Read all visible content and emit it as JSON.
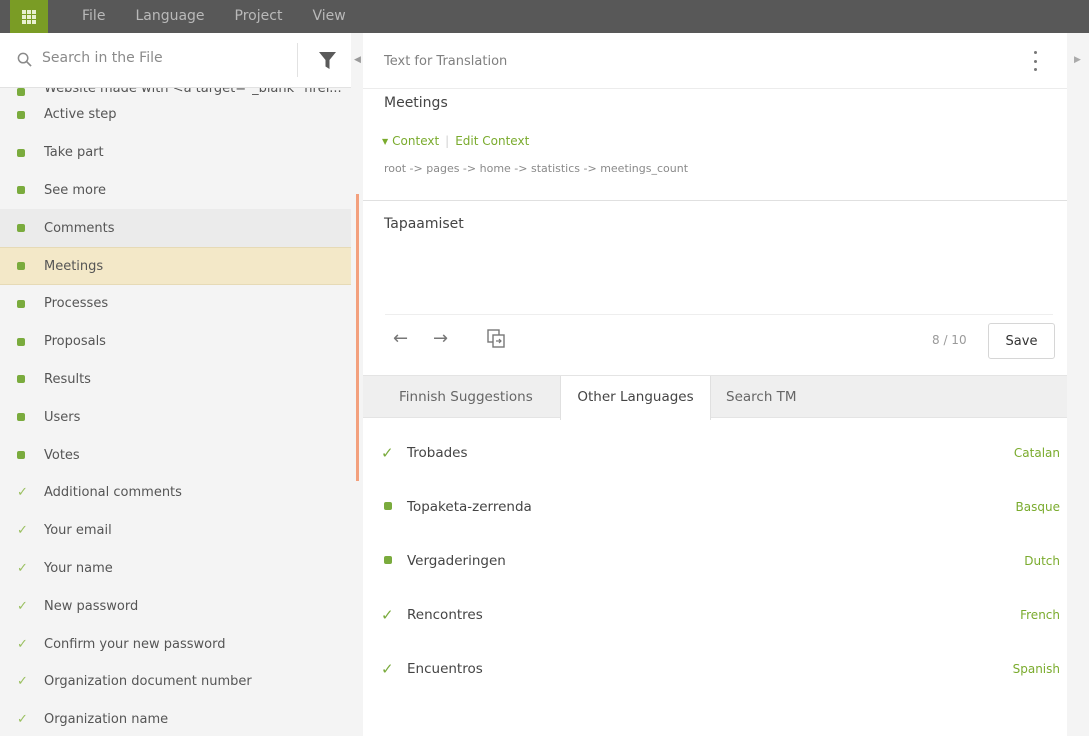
{
  "menubar": {
    "items": [
      "File",
      "Language",
      "Project",
      "View"
    ]
  },
  "sidebar": {
    "search_placeholder": "Search in the File",
    "items": [
      {
        "label": "Website made with <a target=\"_blank\" href...",
        "status": "translated"
      },
      {
        "label": "Active step",
        "status": "translated"
      },
      {
        "label": "Take part",
        "status": "translated"
      },
      {
        "label": "See more",
        "status": "translated"
      },
      {
        "label": "Comments",
        "status": "translated"
      },
      {
        "label": "Meetings",
        "status": "translated"
      },
      {
        "label": "Processes",
        "status": "translated"
      },
      {
        "label": "Proposals",
        "status": "translated"
      },
      {
        "label": "Results",
        "status": "translated"
      },
      {
        "label": "Users",
        "status": "translated"
      },
      {
        "label": "Votes",
        "status": "translated"
      },
      {
        "label": "Additional comments",
        "status": "approved"
      },
      {
        "label": "Your email",
        "status": "approved"
      },
      {
        "label": "Your name",
        "status": "approved"
      },
      {
        "label": "New password",
        "status": "approved"
      },
      {
        "label": "Confirm your new password",
        "status": "approved"
      },
      {
        "label": "Organization document number",
        "status": "approved"
      },
      {
        "label": "Organization name",
        "status": "approved"
      }
    ]
  },
  "editor": {
    "header_title": "Text for Translation",
    "source_text": "Meetings",
    "context_label": "Context",
    "edit_context_label": "Edit Context",
    "context_path": "root -> pages -> home -> statistics -> meetings_count",
    "translation_text": "Tapaamiset",
    "counter": "8 / 10",
    "save_label": "Save"
  },
  "tabs": [
    {
      "label": "Finnish Suggestions"
    },
    {
      "label": "Other Languages"
    },
    {
      "label": "Search TM"
    }
  ],
  "suggestions": [
    {
      "text": "Trobades",
      "language": "Catalan",
      "status": "approved"
    },
    {
      "text": "Topaketa-zerrenda",
      "language": "Basque",
      "status": "translated"
    },
    {
      "text": "Vergaderingen",
      "language": "Dutch",
      "status": "translated"
    },
    {
      "text": "Rencontres",
      "language": "French",
      "status": "approved"
    },
    {
      "text": "Encuentros",
      "language": "Spanish",
      "status": "approved"
    }
  ],
  "colors": {
    "accent_green": "#7aab3d",
    "selected_row": "#f3e8c8",
    "menubar": "#585858",
    "focus_bar": "#f3a07d"
  },
  "icons": {
    "menu_grid": "grid-icon",
    "search": "search-icon",
    "filter": "filter-icon",
    "more": "kebab-icon",
    "prev": "arrow-left-icon",
    "next": "arrow-right-icon",
    "copy": "copy-source-icon",
    "approved": "checkmark-icon",
    "translated": "green-square-icon"
  }
}
